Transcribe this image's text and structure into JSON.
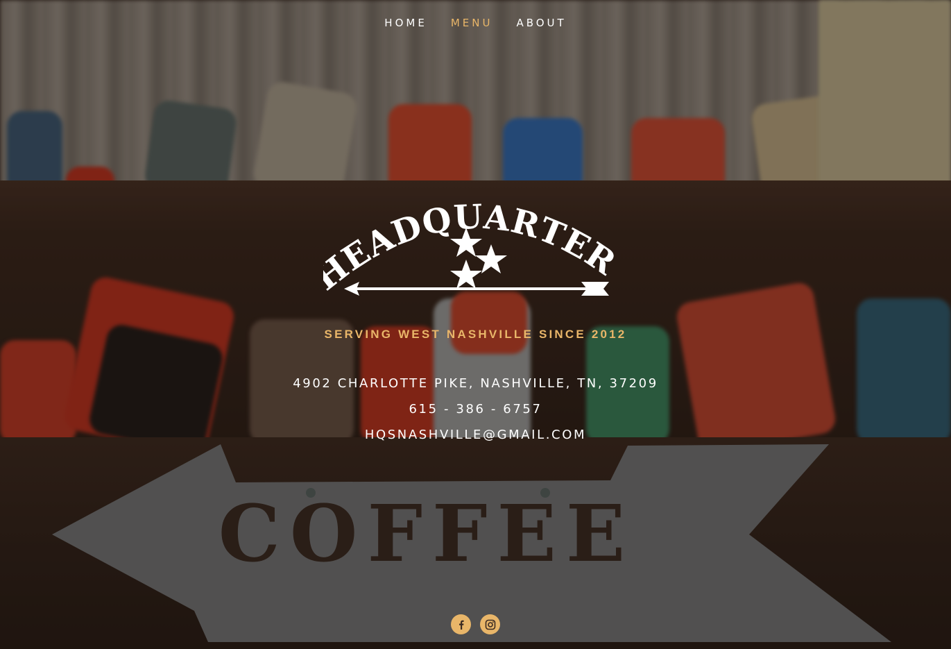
{
  "nav": {
    "items": [
      {
        "label": "HOME"
      },
      {
        "label": "MENU"
      },
      {
        "label": "ABOUT"
      }
    ],
    "active": "MENU"
  },
  "logo": {
    "text": "HEADQUARTERS"
  },
  "tagline": "SERVING WEST NASHVILLE SINCE 2012",
  "contact": {
    "address": "4902 CHARLOTTE PIKE, NASHVILLE, TN, 37209",
    "phone": "615 - 386 - 6757",
    "email": "HQSNASHVILLE@GMAIL.COM"
  },
  "background": {
    "sign_text": "COFFEE"
  },
  "social": [
    {
      "icon": "facebook-icon"
    },
    {
      "icon": "instagram-icon"
    }
  ],
  "colors": {
    "accent": "#e9b669",
    "text": "#ffffff"
  }
}
